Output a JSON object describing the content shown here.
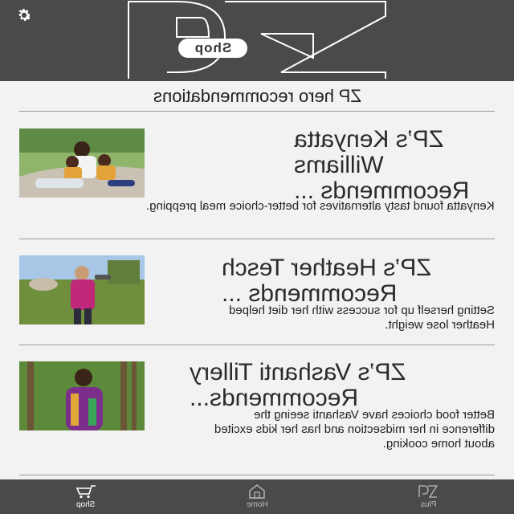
{
  "header": {
    "logo_label": "Shop",
    "settings_icon": "gear-icon"
  },
  "section": {
    "title": "ZP hero recommendations"
  },
  "cards": [
    {
      "heading": "ZP’s Kenyatta Williams Recommends ...",
      "description": "Kenyatta found tasty alternatives for better-choice meal prepping."
    },
    {
      "heading": "ZP’s Heather Tesch Recommends ...",
      "description": "Setting herself up for success with her diet helped Heather lose weight."
    },
    {
      "heading": "ZP’s Vashanti Tillery Recommends...",
      "description": "Better food choices have Vashanti seeing the difference in her midsection and has her kids excited about home cooking."
    }
  ],
  "nav": {
    "items": [
      {
        "label": "Shop",
        "icon": "cart-icon",
        "active": true
      },
      {
        "label": "Home",
        "icon": "home-icon",
        "active": false
      },
      {
        "label": "Plus",
        "icon": "zp-plus-icon",
        "active": false
      }
    ]
  },
  "colors": {
    "header_bg": "#4a4a4a",
    "page_bg": "#f2f2f2",
    "divider": "#999999"
  }
}
